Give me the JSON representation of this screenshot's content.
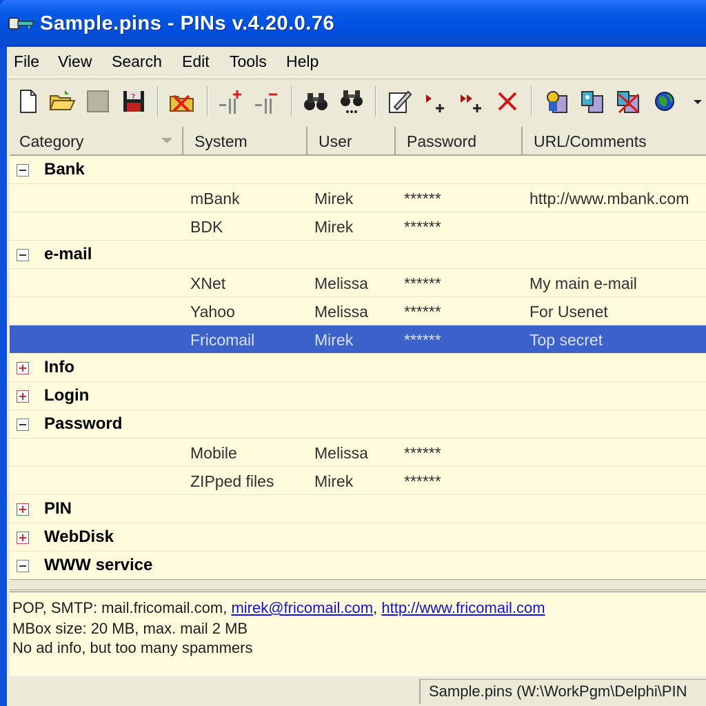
{
  "window": {
    "title": "Sample.pins - PINs v.4.20.0.76"
  },
  "menu": {
    "items": [
      "File",
      "View",
      "Search",
      "Edit",
      "Tools",
      "Help"
    ]
  },
  "toolbar": {
    "icons": [
      "new-file-icon",
      "open-folder-icon",
      "save-icon",
      "close-file-icon",
      "exit-folder-icon",
      "add-category-icon",
      "remove-category-icon",
      "find-icon",
      "find-next-icon",
      "edit-record-icon",
      "add-record-icon",
      "add-record-copy-icon",
      "delete-record-icon",
      "copy-user-icon",
      "copy-password-icon",
      "clear-clipboard-icon",
      "browser-globe-icon",
      "dropdown-arrow-icon"
    ]
  },
  "columns": [
    "Category",
    "System",
    "User",
    "Password",
    "URL/Comments"
  ],
  "rows": [
    {
      "type": "category",
      "label": "Bank",
      "expanded": true
    },
    {
      "type": "record",
      "system": "mBank",
      "user": "Mirek",
      "password": "******",
      "comment": "http://www.mbank.com"
    },
    {
      "type": "record",
      "system": "BDK",
      "user": "Mirek",
      "password": "******",
      "comment": ""
    },
    {
      "type": "category",
      "label": "e-mail",
      "expanded": true
    },
    {
      "type": "record",
      "system": "XNet",
      "user": "Melissa",
      "password": "******",
      "comment": "My main e-mail"
    },
    {
      "type": "record",
      "system": "Yahoo",
      "user": "Melissa",
      "password": "******",
      "comment": "For Usenet"
    },
    {
      "type": "record",
      "system": "Fricomail",
      "user": "Mirek",
      "password": "******",
      "comment": "Top secret",
      "selected": true
    },
    {
      "type": "category",
      "label": "Info",
      "expanded": false
    },
    {
      "type": "category",
      "label": "Login",
      "expanded": false
    },
    {
      "type": "category",
      "label": "Password",
      "expanded": true
    },
    {
      "type": "record",
      "system": "Mobile",
      "user": "Melissa",
      "password": "******",
      "comment": ""
    },
    {
      "type": "record",
      "system": "ZIPped files",
      "user": "Mirek",
      "password": "******",
      "comment": ""
    },
    {
      "type": "category",
      "label": "PIN",
      "expanded": false
    },
    {
      "type": "category",
      "label": "WebDisk",
      "expanded": false
    },
    {
      "type": "category",
      "label": "WWW service",
      "expanded": true
    }
  ],
  "notes": {
    "line1_text": "POP, SMTP: mail.fricomail.com, ",
    "line1_email": "mirek@fricomail.com",
    "line1_sep": ", ",
    "line1_url": "http://www.fricomail.com",
    "line2": "MBox size: 20 MB, max. mail 2 MB",
    "line3": "No ad info, but too many spammers"
  },
  "status": {
    "path": "Sample.pins (W:\\WorkPgm\\Delphi\\PIN"
  },
  "colors": {
    "grid_bg": "#fffbdc",
    "selection": "#3a62c8",
    "titlebar": "#0a5ae8",
    "link": "#1010e8"
  }
}
